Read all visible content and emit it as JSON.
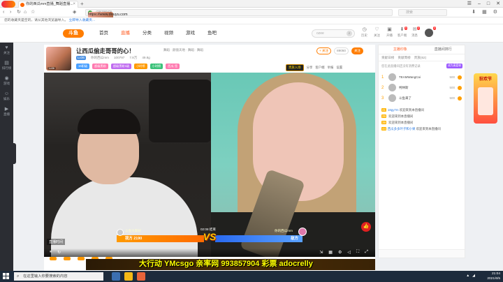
{
  "browser": {
    "tab_title": "你的西瓜mm直播_舞蹈直播...",
    "new_tab": "+",
    "url_host": "https://www.douyu.com",
    "url_path": "/7878973",
    "search_placeholder": "搜索",
    "bookmarks_text": "您的收藏夹是空的，请从其他浏览器导入。",
    "bookmarks_import": "立即导入收藏夹..."
  },
  "site": {
    "logo": "斗鱼",
    "nav": [
      "首页",
      "直播",
      "分类",
      "视频",
      "游戏",
      "鱼吧"
    ],
    "nav_active": 1,
    "search_placeholder": "ozee",
    "icons": [
      {
        "label": "历史",
        "glyph": "◷"
      },
      {
        "label": "关注",
        "glyph": "♡"
      },
      {
        "label": "开播",
        "glyph": "▣"
      },
      {
        "label": "客户端",
        "glyph": "⬇"
      },
      {
        "label": "消息",
        "glyph": "✉"
      }
    ],
    "icon_badges": [
      "",
      "",
      "",
      "5",
      "2"
    ],
    "avatar_badge": "3"
  },
  "left_sidebar": [
    {
      "label": "关注",
      "glyph": "♥"
    },
    {
      "label": "排行榜",
      "glyph": "▤"
    },
    {
      "label": "游戏",
      "glyph": "◉"
    },
    {
      "label": "娱乐",
      "glyph": "☺"
    },
    {
      "label": "直播",
      "glyph": "▶"
    }
  ],
  "room": {
    "title": "让西瓜偷走哥哥的心！",
    "category": "舞蹈 · 颜值天地 · 舞蹈 · 舞蹈",
    "meta": [
      "你的西瓜mm",
      "100797",
      "7.9万",
      "49.8g"
    ],
    "lv_badge": "Lv36",
    "tags": [
      "16职级",
      "超级黑粉",
      "超级黑粉1级",
      "小时榜",
      "小时榜",
      "西瓜·签"
    ],
    "tag_colors": [
      "#4aa0ff",
      "#ff7ab0",
      "#c06cf0",
      "#ff9a00",
      "#3cc27a",
      "#ff7ab0"
    ],
    "follow_buttons": [
      "+ 关注",
      "89050",
      "关注"
    ],
    "toolbar": [
      "分享",
      "客户端",
      "举报",
      "设置"
    ],
    "vip_entry": "贵族入场"
  },
  "video": {
    "watermark": "直播时间",
    "pk_left_name": "斗鱼大家好",
    "pk_left_score": "我方 2190",
    "pk_timer": "02:08 结束",
    "pk_vs": "VS",
    "pk_right_name": "你的西瓜mm",
    "pk_right_score": "敌方",
    "like_glyph": "👍",
    "ctrl_left": [
      "⏸",
      "↻"
    ],
    "ctrl_right": [
      "⇲",
      "▦",
      "⚙",
      "◁",
      "⛶",
      "⤢"
    ]
  },
  "banner": {
    "ad_text": "大行动  YMcsgo  亲率网  993857904  彩票  adocrelly"
  },
  "right_panel": {
    "tabs": [
      "主播印象",
      "直播间排行"
    ],
    "sub_tabs": [
      "贡献日榜",
      "贡献周榜",
      "贵族(62)"
    ],
    "notice": "您在此直播间还没有消费记录",
    "notice_btn": "成为真爱粉",
    "ranks": [
      {
        "rank": "1",
        "name": "TEAMWangCai",
        "score": "500"
      },
      {
        "rank": "2",
        "name": "柯林斯",
        "score": "500"
      },
      {
        "rank": "3",
        "name": "斗鱼来了",
        "score": "500"
      }
    ],
    "chats": [
      {
        "lv": "41",
        "name": "18gy7m",
        "text": "欢迎来到本直播间"
      },
      {
        "lv": "29",
        "name": "",
        "text": "欢迎来到本直播间"
      },
      {
        "lv": "39",
        "name": "",
        "text": "欢迎来到本直播间"
      },
      {
        "lv": "44",
        "name": "西瓜多多叶子和小果",
        "text": "欢迎来到本直播间"
      }
    ]
  },
  "event": {
    "title": "狂欢节"
  },
  "taskbar": {
    "search": "在这里输入你要搜索的内容",
    "time": "21:04",
    "date": "2021/6/5"
  },
  "colors": {
    "accent": "#ff5d23",
    "douyu_orange": "#ff7d00",
    "pk_orange": "#ff7a00",
    "pk_blue": "#3478f6"
  }
}
